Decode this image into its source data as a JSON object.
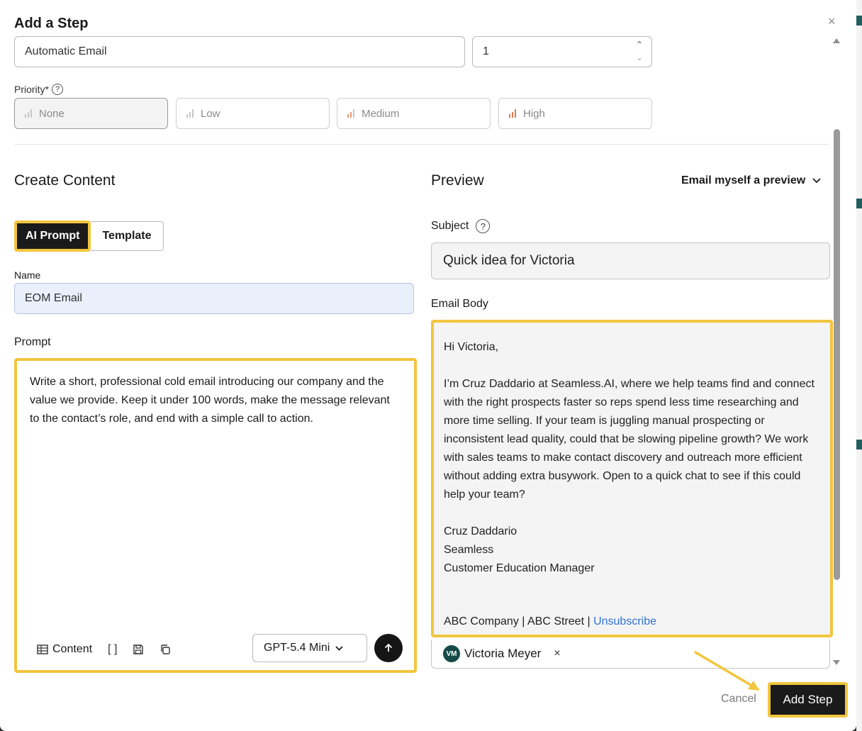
{
  "dialog": {
    "title": "Add a Step",
    "close_glyph": "×"
  },
  "step": {
    "type_value": "Automatic Email",
    "number_value": "1"
  },
  "priority": {
    "label": "Priority*",
    "help_glyph": "?",
    "options": [
      {
        "label": "None",
        "selected": true
      },
      {
        "label": "Low",
        "selected": false
      },
      {
        "label": "Medium",
        "selected": false
      },
      {
        "label": "High",
        "selected": false
      }
    ]
  },
  "create": {
    "heading": "Create Content",
    "tabs": [
      {
        "label": "AI Prompt",
        "active": true
      },
      {
        "label": "Template",
        "active": false
      }
    ],
    "name_label": "Name",
    "name_value": "EOM Email",
    "prompt_label": "Prompt",
    "prompt_text": "Write a short, professional cold email introducing our company and the value we provide. Keep it under 100 words, make the message relevant to the contact’s role, and end with a simple call to action.",
    "tools": {
      "content_label": "Content",
      "brackets_label": "[ ]"
    },
    "model_value": "GPT-5.4 Mini"
  },
  "preview": {
    "heading": "Preview",
    "email_myself_label": "Email myself a preview",
    "subject_label": "Subject",
    "subject_value": "Quick idea for Victoria",
    "body_label": "Email Body",
    "body": {
      "greeting": "Hi Victoria,",
      "paragraph": "I’m Cruz Daddario at Seamless.AI, where we help teams find and connect with the right prospects faster so reps spend less time researching and more time selling. If your team is juggling manual prospecting or inconsistent lead quality, could that be slowing pipeline growth? We work with sales teams to make contact discovery and outreach more efficient without adding extra busywork. Open to a quick chat to see if this could help your team?",
      "signature_name": "Cruz Daddario",
      "signature_company": "Seamless",
      "signature_title": "Customer Education Manager",
      "footer_text": "ABC Company | ABC Street | ",
      "unsubscribe_label": "Unsubscribe"
    },
    "recipient": {
      "initials": "VM",
      "name": "Victoria Meyer",
      "remove_glyph": "×"
    }
  },
  "actions": {
    "cancel_label": "Cancel",
    "add_step_label": "Add Step"
  },
  "colors": {
    "highlight": "#f2c53d",
    "primary_button": "#1a1a1a",
    "link": "#2f73d2",
    "avatar": "#164a47"
  }
}
